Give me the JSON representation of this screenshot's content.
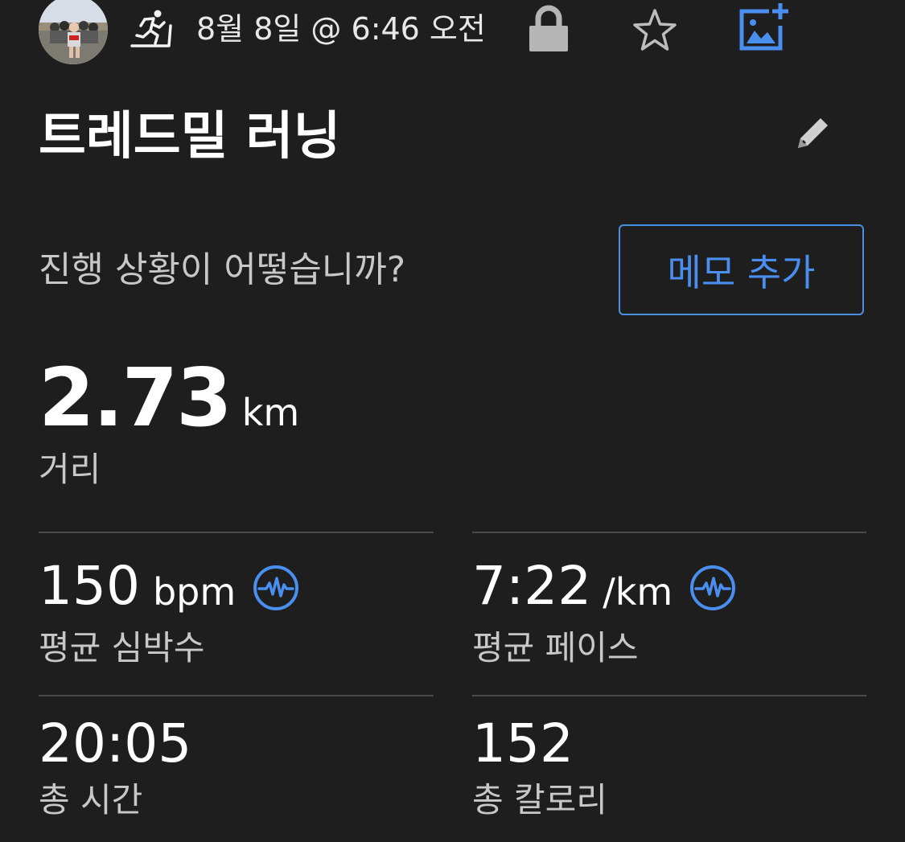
{
  "header": {
    "date_time": "8월 8일 @ 6:46 오전",
    "icons": [
      "avatar",
      "treadmill-run-icon",
      "lock-icon",
      "star-icon",
      "add-photo-icon"
    ]
  },
  "activity": {
    "title": "트레드밀 러닝",
    "edit_icon": "pencil-icon"
  },
  "feedback": {
    "prompt": "진행 상황이 어떻습니까?",
    "memo_button": "메모 추가"
  },
  "distance": {
    "value": "2.73",
    "unit": "km",
    "label": "거리"
  },
  "stats": {
    "heart_rate": {
      "value": "150",
      "unit": "bpm",
      "label": "평균 심박수"
    },
    "pace": {
      "value": "7:22",
      "unit": "/km",
      "label": "평균 페이스"
    },
    "time": {
      "value": "20:05",
      "label": "총 시간"
    },
    "calories": {
      "value": "152",
      "label": "총 칼로리"
    }
  },
  "colors": {
    "background": "#1e1e1e",
    "accent": "#4a8ff0",
    "divider": "#4a4a4a",
    "secondary_text": "#c8c8c8"
  }
}
